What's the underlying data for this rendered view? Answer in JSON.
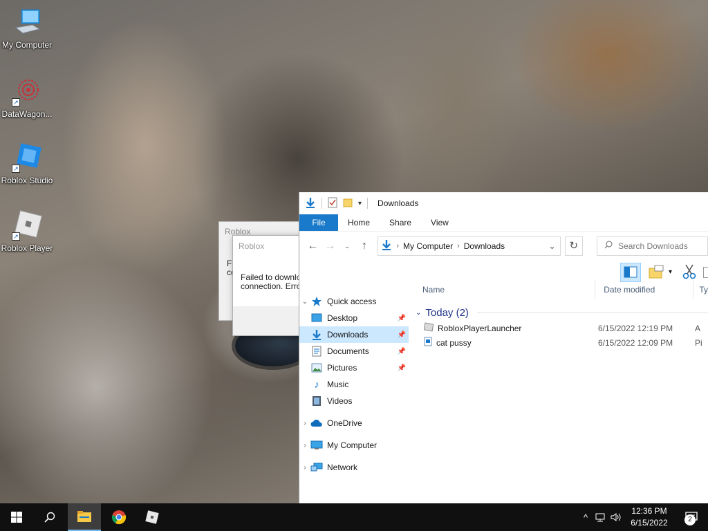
{
  "desktop": {
    "icons": [
      {
        "label": "My Computer",
        "icon": "computer-icon"
      },
      {
        "label": "DataWagon...",
        "icon": "datawagon-icon"
      },
      {
        "label": "Roblox Studio",
        "icon": "roblox-studio-icon"
      },
      {
        "label": "Roblox Player",
        "icon": "roblox-player-icon"
      }
    ]
  },
  "roblox_dialog_back": {
    "title": "Roblox",
    "line1": "Fa",
    "line2": "co"
  },
  "roblox_dialog_front": {
    "title": "Roblox",
    "line1": "Failed to downlo",
    "line2": "connection. Erro"
  },
  "explorer": {
    "title": "Downloads",
    "tabs": [
      "File",
      "Home",
      "Share",
      "View"
    ],
    "breadcrumb": [
      "My Computer",
      "Downloads"
    ],
    "search_placeholder": "Search Downloads",
    "nav": {
      "quick_access": "Quick access",
      "items": [
        {
          "label": "Desktop",
          "icon": "desktop-folder-icon",
          "pinned": true
        },
        {
          "label": "Downloads",
          "icon": "downloads-folder-icon",
          "pinned": true,
          "selected": true
        },
        {
          "label": "Documents",
          "icon": "documents-folder-icon",
          "pinned": true
        },
        {
          "label": "Pictures",
          "icon": "pictures-folder-icon",
          "pinned": true
        },
        {
          "label": "Music",
          "icon": "music-folder-icon",
          "pinned": false
        },
        {
          "label": "Videos",
          "icon": "videos-folder-icon",
          "pinned": false
        }
      ],
      "onedrive": "OneDrive",
      "my_computer": "My Computer",
      "network": "Network"
    },
    "columns": {
      "name": "Name",
      "date": "Date modified",
      "type": "Ty"
    },
    "group": "Today (2)",
    "files": [
      {
        "name": "RobloxPlayerLauncher",
        "date": "6/15/2022 12:19 PM",
        "type": "A"
      },
      {
        "name": "cat pussy",
        "date": "6/15/2022 12:09 PM",
        "type": "Pi"
      }
    ]
  },
  "taskbar": {
    "time": "12:36 PM",
    "date": "6/15/2022",
    "notification_count": "2"
  },
  "colors": {
    "accent": "#1979ca",
    "selection": "#cce8ff",
    "taskbar": "#101010",
    "group_header": "#1e3287"
  }
}
